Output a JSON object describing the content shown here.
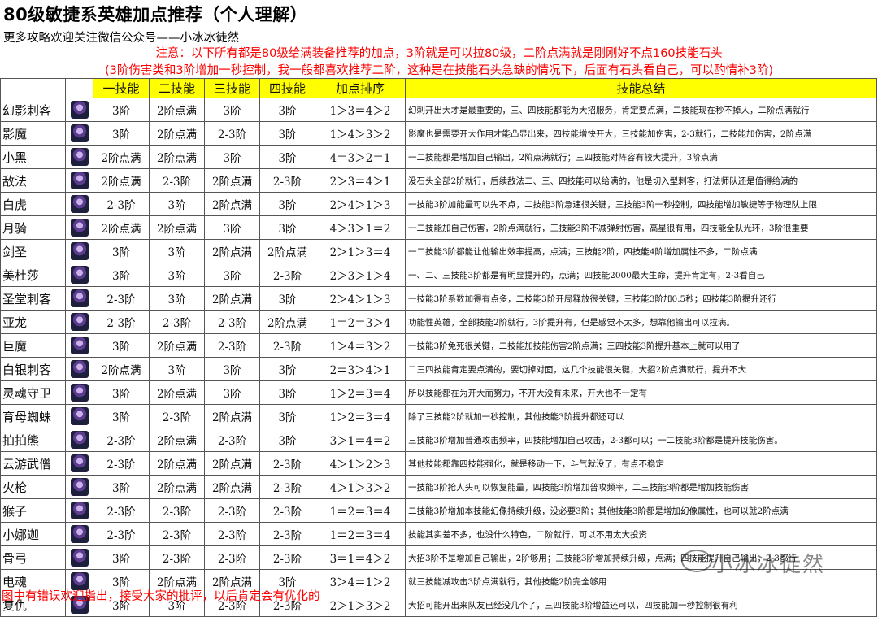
{
  "title": "80级敏捷系英雄加点推荐（个人理解）",
  "subtitle": "更多攻略欢迎关注微信公众号——小冰冰徒然",
  "note_line1": "注意：以下所有都是80级给满装备推荐的加点，3阶就是可以拉80级，二阶点满就是刚刚好不点160技能石头",
  "note_line2": "(3阶伤害类和3阶增加一秒控制，我一般都喜欢推荐二阶，这种是在技能石头急缺的情况下，后面有石头看自己，可以酌情补3阶)",
  "headers": [
    "一技能",
    "二技能",
    "三技能",
    "四技能",
    "加点排序",
    "技能总结"
  ],
  "rows": [
    {
      "name": "幻影刺客",
      "s1": "3阶",
      "s2": "2阶点满",
      "s3": "3阶",
      "s4": "3阶",
      "order": "1＞3＝4＞2",
      "summary": "幻刺开出大才是最重要的，三、四技能都能为大招服务，肯定要点满，二技能现在秒不掉人，二阶点满就行"
    },
    {
      "name": "影魔",
      "s1": "3阶",
      "s2": "2阶点满",
      "s3": "2-3阶",
      "s4": "3阶",
      "order": "1＞4＞3＞2",
      "summary": "影魔也是需要开大作用才能凸显出来，四技能增快开大，三技能加伤害，2-3就行，二技能加伤害，2阶点满"
    },
    {
      "name": "小黑",
      "s1": "2阶点满",
      "s2": "2阶点满",
      "s3": "3阶",
      "s4": "3阶",
      "order": "4＝3＞2＝1",
      "summary": "一二技能都是增加自己输出，2阶点满就行；三四技能对阵容有较大提升，3阶点满"
    },
    {
      "name": "敌法",
      "s1": "2阶点满",
      "s2": "2-3阶",
      "s3": "2阶点满",
      "s4": "2-3阶",
      "order": "2＞3＝4＞1",
      "summary": "没石头全部2阶就行，后续敌法二、三、四技能可以给满的，他是切入型刺客，打法师队还是值得给满的"
    },
    {
      "name": "白虎",
      "s1": "2-3阶",
      "s2": "3阶",
      "s3": "2阶点满",
      "s4": "3阶",
      "order": "2＞4＞1＞3",
      "summary": "一技能3阶加能量可以先不点，二技能3阶急速很关键，三技能3阶一秒控制，四技能增加敏捷等于物理队上限"
    },
    {
      "name": "月骑",
      "s1": "2阶点满",
      "s2": "2阶点满",
      "s3": "3阶",
      "s4": "3阶",
      "order": "4＞3＞1＝2",
      "summary": "一二技能加自己伤害，2阶点满就行，三技能3阶不减弹射伤害，高星很有用，四技能全队光环，3阶很重要"
    },
    {
      "name": "剑圣",
      "s1": "3阶",
      "s2": "3阶",
      "s3": "2阶点满",
      "s4": "2阶点满",
      "order": "2＞1＞3＝4",
      "summary": "一二技能3阶都能让他输出效率提高，点满；三技能2阶，四技能4阶增加属性不多，二阶点满"
    },
    {
      "name": "美杜莎",
      "s1": "3阶",
      "s2": "3阶",
      "s3": "3阶",
      "s4": "2-3阶",
      "order": "2＞3＞1＞4",
      "summary": "一、二、三技能3阶都是有明显提升的，点满；四技能2000最大生命，提升肯定有，2-3看自己"
    },
    {
      "name": "圣堂刺客",
      "s1": "2-3阶",
      "s2": "3阶",
      "s3": "2阶点满",
      "s4": "3阶",
      "order": "2＞4＞1＞3",
      "summary": "一技能3阶系数加得有点多，二技能3阶开局释放很关键，三技能3阶加0.5秒；四技能3阶提升还行"
    },
    {
      "name": "亚龙",
      "s1": "2-3阶",
      "s2": "2-3阶",
      "s3": "2-3阶",
      "s4": "2阶点满",
      "order": "1＝2＝3＞4",
      "summary": "功能性英雄，全部技能2阶就行，3阶提升有，但是感觉不太多，想靠他输出可以拉满。"
    },
    {
      "name": "巨魔",
      "s1": "3阶",
      "s2": "2阶点满",
      "s3": "2-3阶",
      "s4": "2-3阶",
      "order": "1＞4＝3＞2",
      "summary": "一技能3阶免死很关键，二技能加技能伤害2阶点满；三四技能3阶提升基本上就可以用了"
    },
    {
      "name": "白银刺客",
      "s1": "2阶点满",
      "s2": "3阶",
      "s3": "3阶",
      "s4": "3阶",
      "order": "2＝3＞4＞1",
      "summary": "二三四技能肯定要点满的，要切掉对面，这几个技能很关键，大招2阶点满就行，提升不大"
    },
    {
      "name": "灵魂守卫",
      "s1": "3阶",
      "s2": "2阶点满",
      "s3": "3阶",
      "s4": "3阶",
      "order": "1＞2＝3＝4",
      "summary": "所以技能都在为开大而努力，不开大没有未来，开大也不一定有"
    },
    {
      "name": "育母蜘蛛",
      "s1": "3阶",
      "s2": "2-3阶",
      "s3": "2阶点满",
      "s4": "3阶",
      "order": "1＞2＝3＝4",
      "summary": "除了三技能2阶就加一秒控制，其他技能3阶提升都还可以"
    },
    {
      "name": "拍拍熊",
      "s1": "2-3阶",
      "s2": "2阶点满",
      "s3": "2-3阶",
      "s4": "3阶",
      "order": "3＞1＝4＝2",
      "summary": "三技能3阶增加普通攻击频率，四技能增加自己攻击，2-3都可以；一二技能3阶都是提升技能伤害。"
    },
    {
      "name": "云游武僧",
      "s1": "2-3阶",
      "s2": "2阶点满",
      "s3": "2阶点满",
      "s4": "2-3阶",
      "order": "4＞1＞2＞3",
      "summary": "其他技能都靠四技能强化，就是移动一下，斗气就没了，有点不稳定"
    },
    {
      "name": "火枪",
      "s1": "3阶",
      "s2": "2阶点满",
      "s3": "2阶点满",
      "s4": "2-3阶",
      "order": "4＞1＞3＞2",
      "summary": "一技能3阶抢人头可以恢复能量，四技能3阶增加普攻频率，二三技能3阶都是增加技能伤害"
    },
    {
      "name": "猴子",
      "s1": "2-3阶",
      "s2": "2-3阶",
      "s3": "2-3阶",
      "s4": "2-3阶",
      "order": "1＝2＝3＝4",
      "summary": "二技能3阶增加本技能幻像持续升级，没必要3阶；其他技能3阶都是增加幻像属性，也可以就2阶点满"
    },
    {
      "name": "小娜迦",
      "s1": "2-3阶",
      "s2": "2-3阶",
      "s3": "2-3阶",
      "s4": "2-3阶",
      "order": "1＝2＝3＝4",
      "summary": "技能其实差不多，也没什么特色，二阶就行，可以不用太大投资"
    },
    {
      "name": "骨弓",
      "s1": "3阶",
      "s2": "2-3阶",
      "s3": "2-3阶",
      "s4": "2-3阶",
      "order": "3＝1＝4＞2",
      "summary": "大招3阶不是增加自己输出，2阶够用；三技能3阶增加持续升级，点满；四技能提升自己输出，2-3都行"
    },
    {
      "name": "电魂",
      "s1": "3阶",
      "s2": "2阶点满",
      "s3": "2阶点满",
      "s4": "3阶",
      "order": "3＞4＝1＞2",
      "summary": "就三技能减攻击3阶点满就行，其他技能2阶完全够用"
    },
    {
      "name": "复仇",
      "s1": "3阶",
      "s2": "3阶",
      "s3": "2-3阶",
      "s4": "2-3阶",
      "order": "2＞1＞3＞2",
      "summary": "大招可能开出来队友已经没几个了，三四技能3阶增益还可以，四技能加一秒控制很有利"
    }
  ],
  "footer": "图中有错误欢迎指出，接受大家的批评，以后肯定会有优化的",
  "watermark": "小冰冰徒然"
}
